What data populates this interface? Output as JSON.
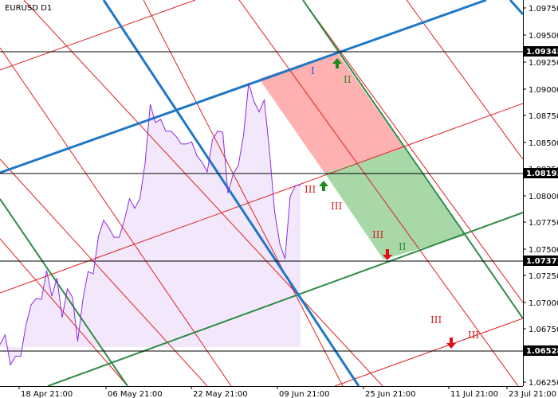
{
  "chart_data": {
    "type": "line",
    "title": "EURUSD D1",
    "x": [
      "18 Apr 21:00",
      "06 May 21:00",
      "22 May 21:00",
      "09 Jun 21:00",
      "25 Jun 21:00",
      "11 Jul 21:00",
      "23 Jul 21:00"
    ],
    "y_ticks": [
      "1.09750",
      "1.09500",
      "1.09250",
      "1.09000",
      "1.08750",
      "1.08500",
      "1.08250",
      "1.08000",
      "1.07750",
      "1.07500",
      "1.07250",
      "1.07000",
      "1.06750",
      "1.06250"
    ],
    "ylim": [
      1.0625,
      1.0975
    ],
    "levels": [
      {
        "label": "1.09345",
        "value": 1.09345
      },
      {
        "label": "1.08193",
        "value": 1.08193
      },
      {
        "label": "1.07371",
        "value": 1.07371
      },
      {
        "label": "1.06528",
        "value": 1.06528
      }
    ],
    "price_series": {
      "name": "",
      "color": "#8a2be2",
      "values": [
        1.0663,
        1.0672,
        1.0644,
        1.0652,
        1.0652,
        1.0681,
        1.07,
        1.0706,
        1.0705,
        1.0732,
        1.0708,
        1.0725,
        1.0688,
        1.0715,
        1.0707,
        1.0666,
        1.0705,
        1.0731,
        1.0729,
        1.0764,
        1.0779,
        1.0772,
        1.0763,
        1.0763,
        1.0779,
        1.0799,
        1.079,
        1.0799,
        1.0832,
        1.0887,
        1.087,
        1.0873,
        1.0862,
        1.0862,
        1.0857,
        1.085,
        1.085,
        1.0852,
        1.0839,
        1.0833,
        1.0824,
        1.0854,
        1.0862,
        1.0861,
        1.0804,
        1.0822,
        1.083,
        1.0858,
        1.0907,
        1.089,
        1.088,
        1.0891,
        1.0844,
        1.0787,
        1.0757,
        1.0743,
        1.0801,
        1.0811,
        1.0812
      ]
    },
    "roman_labels": [
      {
        "text": "I",
        "color": "#3355cc"
      },
      {
        "text": "II",
        "color": "#2e8b2e"
      },
      {
        "text": "III",
        "color": "#d42020"
      },
      {
        "text": "III",
        "color": "#d42020"
      },
      {
        "text": "III",
        "color": "#d42020"
      },
      {
        "text": "II",
        "color": "#2e8b2e"
      },
      {
        "text": "III",
        "color": "#d42020"
      },
      {
        "text": "III",
        "color": "#d42020"
      }
    ],
    "colors": {
      "trend_blue": "#1f77c8",
      "fan_green": "#2e8b45",
      "grid_red": "#e02020",
      "zone_red": "#ffb0b0",
      "zone_green": "#a8d8a8",
      "area_fill": "#f3e8fb",
      "arrow_up": "#1a8a1a",
      "arrow_down": "#e01010"
    },
    "grid": false,
    "legend": "none"
  }
}
